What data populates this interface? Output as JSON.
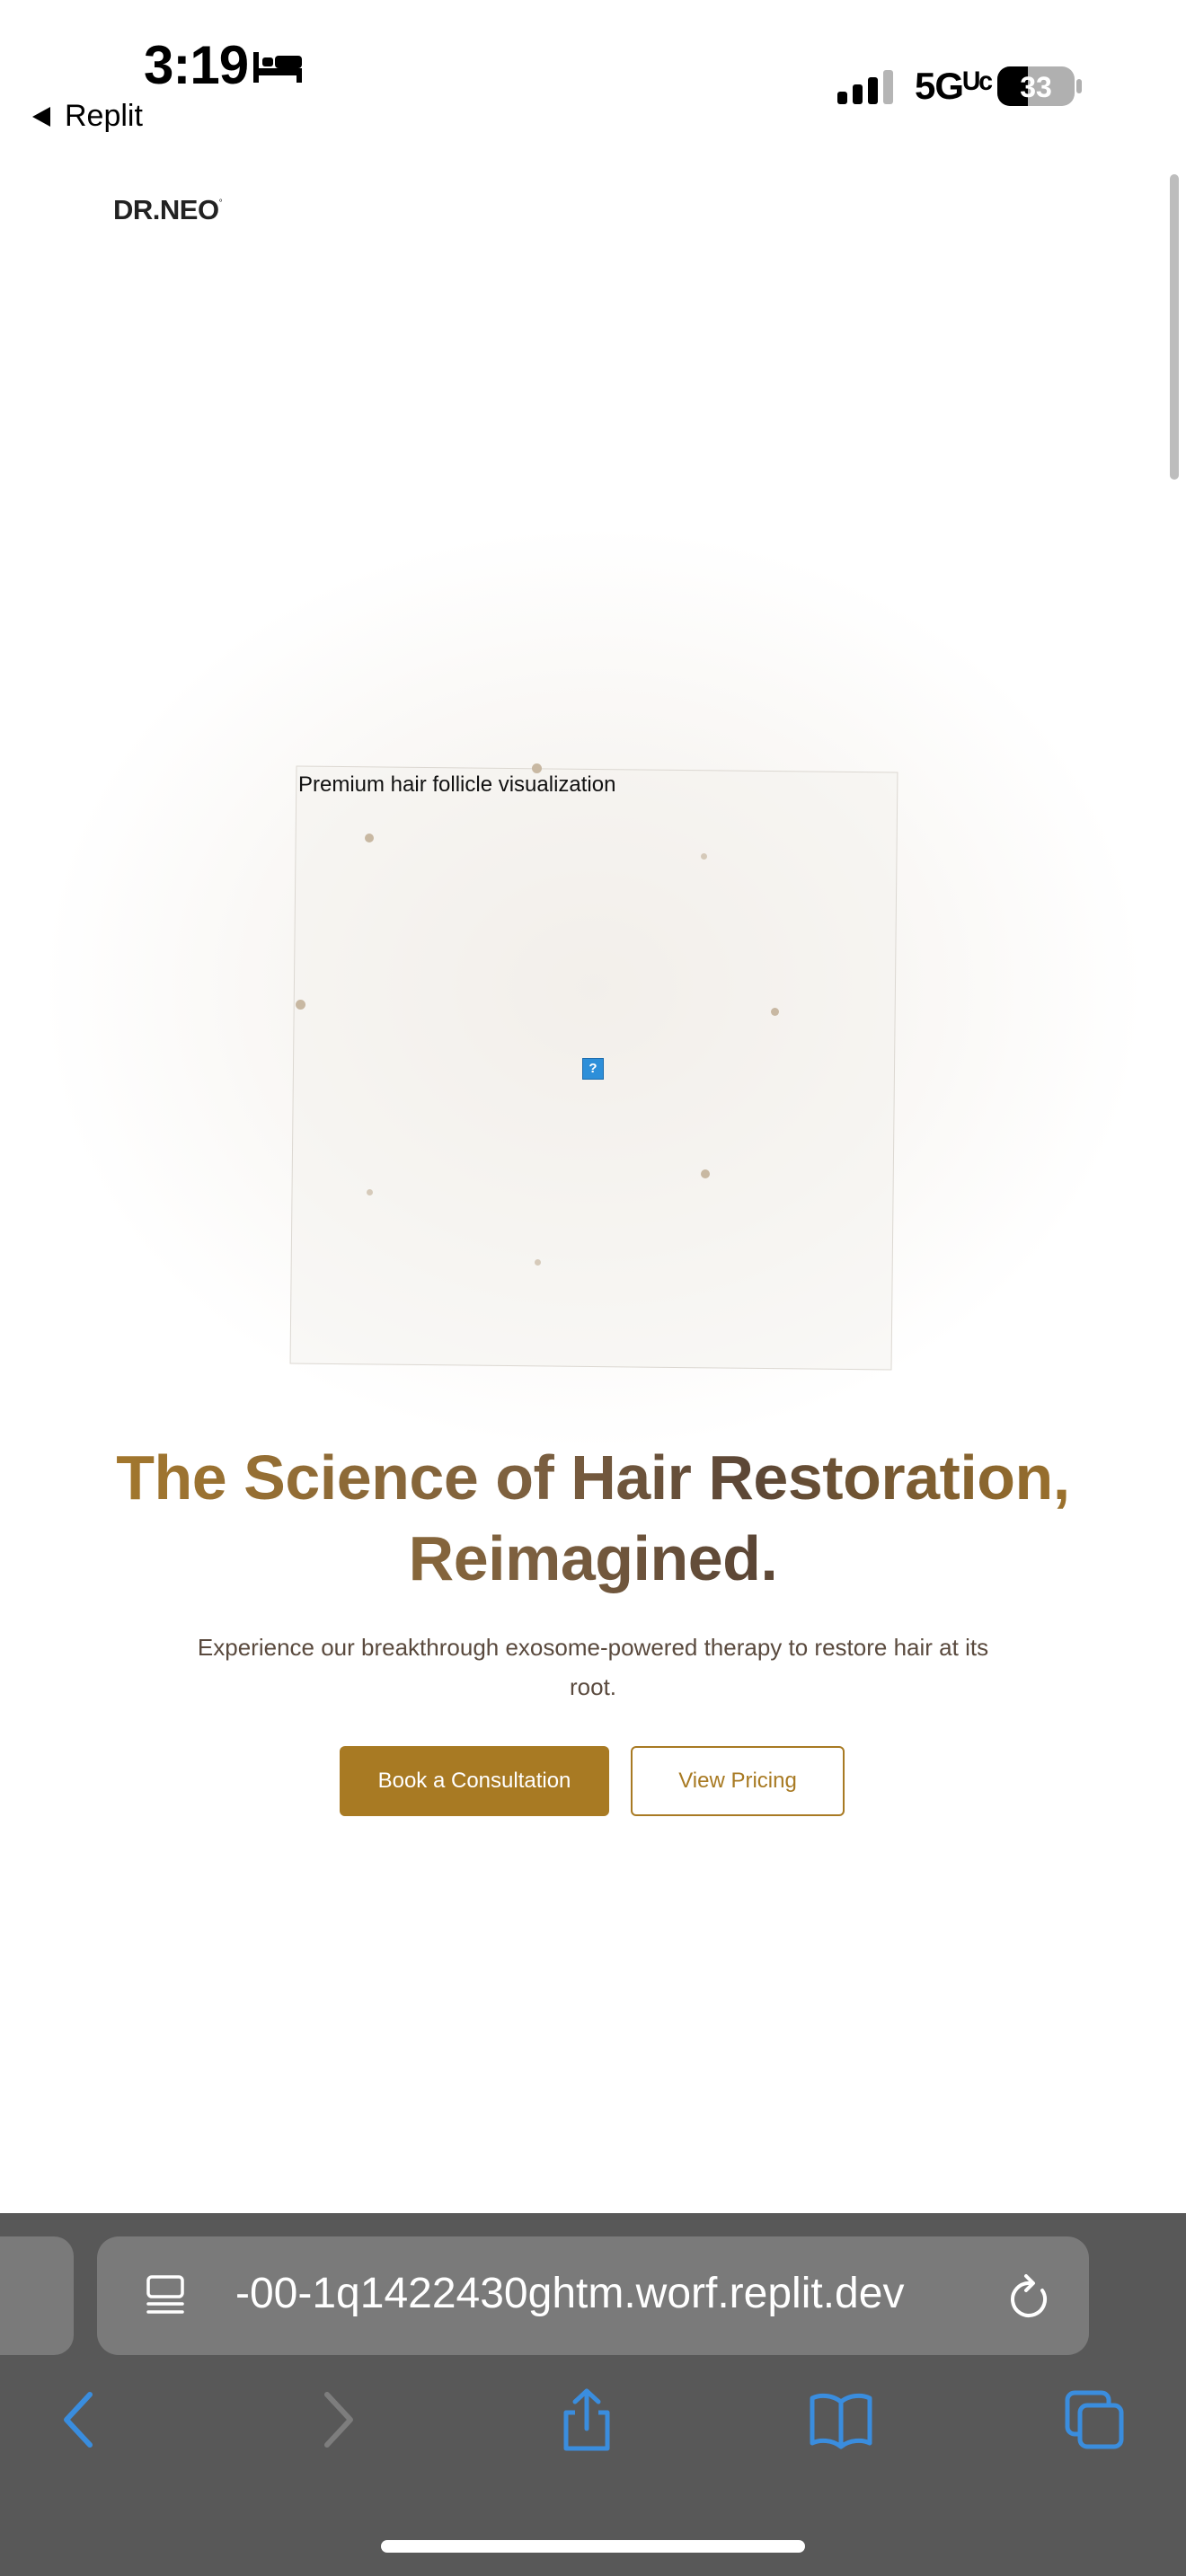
{
  "status_bar": {
    "time": "3:19",
    "back_app": "Replit",
    "network": "5Gᵁᶜ",
    "battery": "33",
    "icons": [
      "bed-icon",
      "signal-icon",
      "battery-icon"
    ]
  },
  "page": {
    "logo": "DR.NEO",
    "logo_mark": "°",
    "hero_image_alt": "Premium hair follicle visualization",
    "broken_image_glyph": "?",
    "headline_line1": "The Science of Hair Restoration,",
    "headline_line2": "Reimagined.",
    "subtext": "Experience our breakthrough exosome-powered therapy to restore hair at its root.",
    "primary_cta": "Book a Consultation",
    "secondary_cta": "View Pricing",
    "colors": {
      "gold": "#a87a23",
      "brown": "#5b4636",
      "text_muted": "#5a4a3e"
    }
  },
  "browser": {
    "url": "-00-1q1422430ghtm.worf.replit.dev",
    "toolbar_icons": [
      "back-icon",
      "forward-icon",
      "share-icon",
      "bookmarks-icon",
      "tabs-icon"
    ],
    "chrome_color": "#585858",
    "accent": "#3a8dde"
  }
}
